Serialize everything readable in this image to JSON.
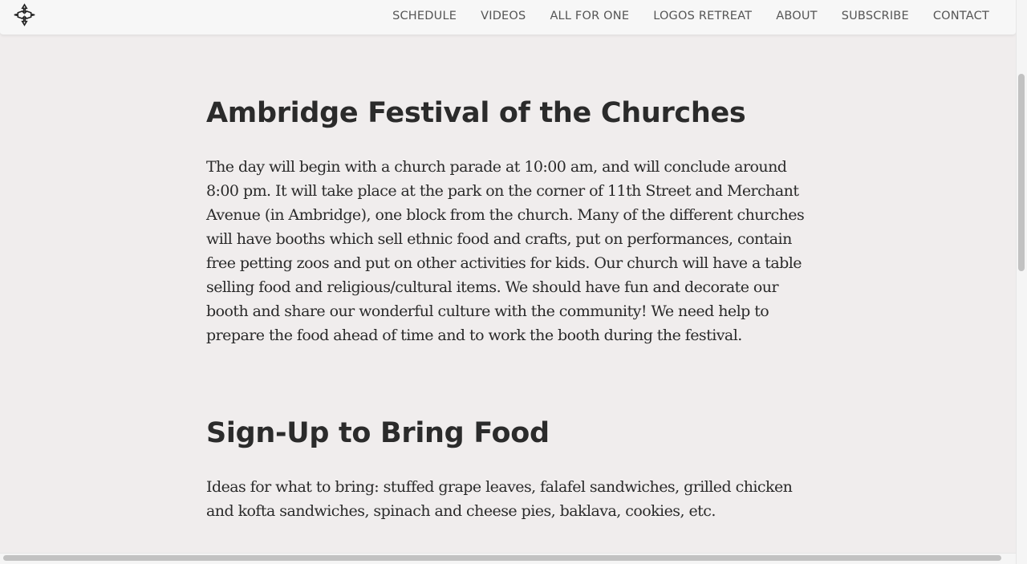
{
  "nav": {
    "logo_icon": "cross-emblem-icon",
    "links": [
      "SCHEDULE",
      "VIDEOS",
      "ALL FOR ONE",
      "LOGOS RETREAT",
      "ABOUT",
      "SUBSCRIBE",
      "CONTACT"
    ]
  },
  "main": {
    "section1": {
      "title": "Ambridge Festival of the Churches",
      "body": "The day will begin with a church parade at 10:00 am, and will conclude around 8:00 pm. It will take place at the park on the corner of 11th Street and Merchant Avenue (in Ambridge), one block from the church. Many of the different churches will have booths which sell ethnic food and crafts, put on performances, contain free petting zoos and put on other activities for kids. Our church will have a table selling food and religious/cultural items. We should have fun and decorate our booth and share our wonderful culture with the community! We need help to prepare the food ahead of time and to work the booth during the festival."
    },
    "section2": {
      "title": "Sign-Up to Bring Food",
      "body": "Ideas for what to bring: stuffed grape leaves, falafel sandwiches, grilled chicken and kofta sandwiches, spinach and cheese pies, baklava, cookies, etc."
    }
  },
  "colors": {
    "page_background": "#f0eded",
    "navbar_background": "#f7f7f7",
    "heading_text": "#2b2b2b",
    "body_text": "#2a2a2a",
    "nav_text": "#555555"
  }
}
